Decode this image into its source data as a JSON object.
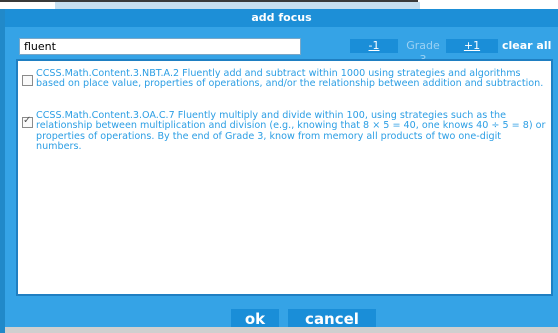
{
  "dialog": {
    "title": "add focus",
    "search": {
      "value": "fluent",
      "placeholder": ""
    },
    "grade": {
      "minus_label": "-1",
      "label": "Grade 3",
      "plus_label": "+1",
      "clear_label": "clear all"
    },
    "items": [
      {
        "checked": false,
        "text": "CCSS.Math.Content.3.NBT.A.2 Fluently add and subtract within 1000 using strategies and algorithms based on place value, properties of operations, and/or the relationship between addition and subtraction."
      },
      {
        "checked": true,
        "text": "CCSS.Math.Content.3.OA.C.7 Fluently multiply and divide within 100, using strategies such as the relationship between multiplication and division (e.g., knowing that 8 × 5 = 40, one knows 40 ÷ 5 = 8) or properties of operations. By the end of Grade 3, know from memory all products of two one-digit numbers."
      }
    ],
    "ok_label": "ok",
    "cancel_label": "cancel"
  },
  "colors": {
    "panel_blue": "#35a3e6",
    "title_blue": "#1d8fd7",
    "button_blue": "#1a8ed8",
    "item_text": "#2c9ee4",
    "grade_label": "#9bd1f3"
  }
}
